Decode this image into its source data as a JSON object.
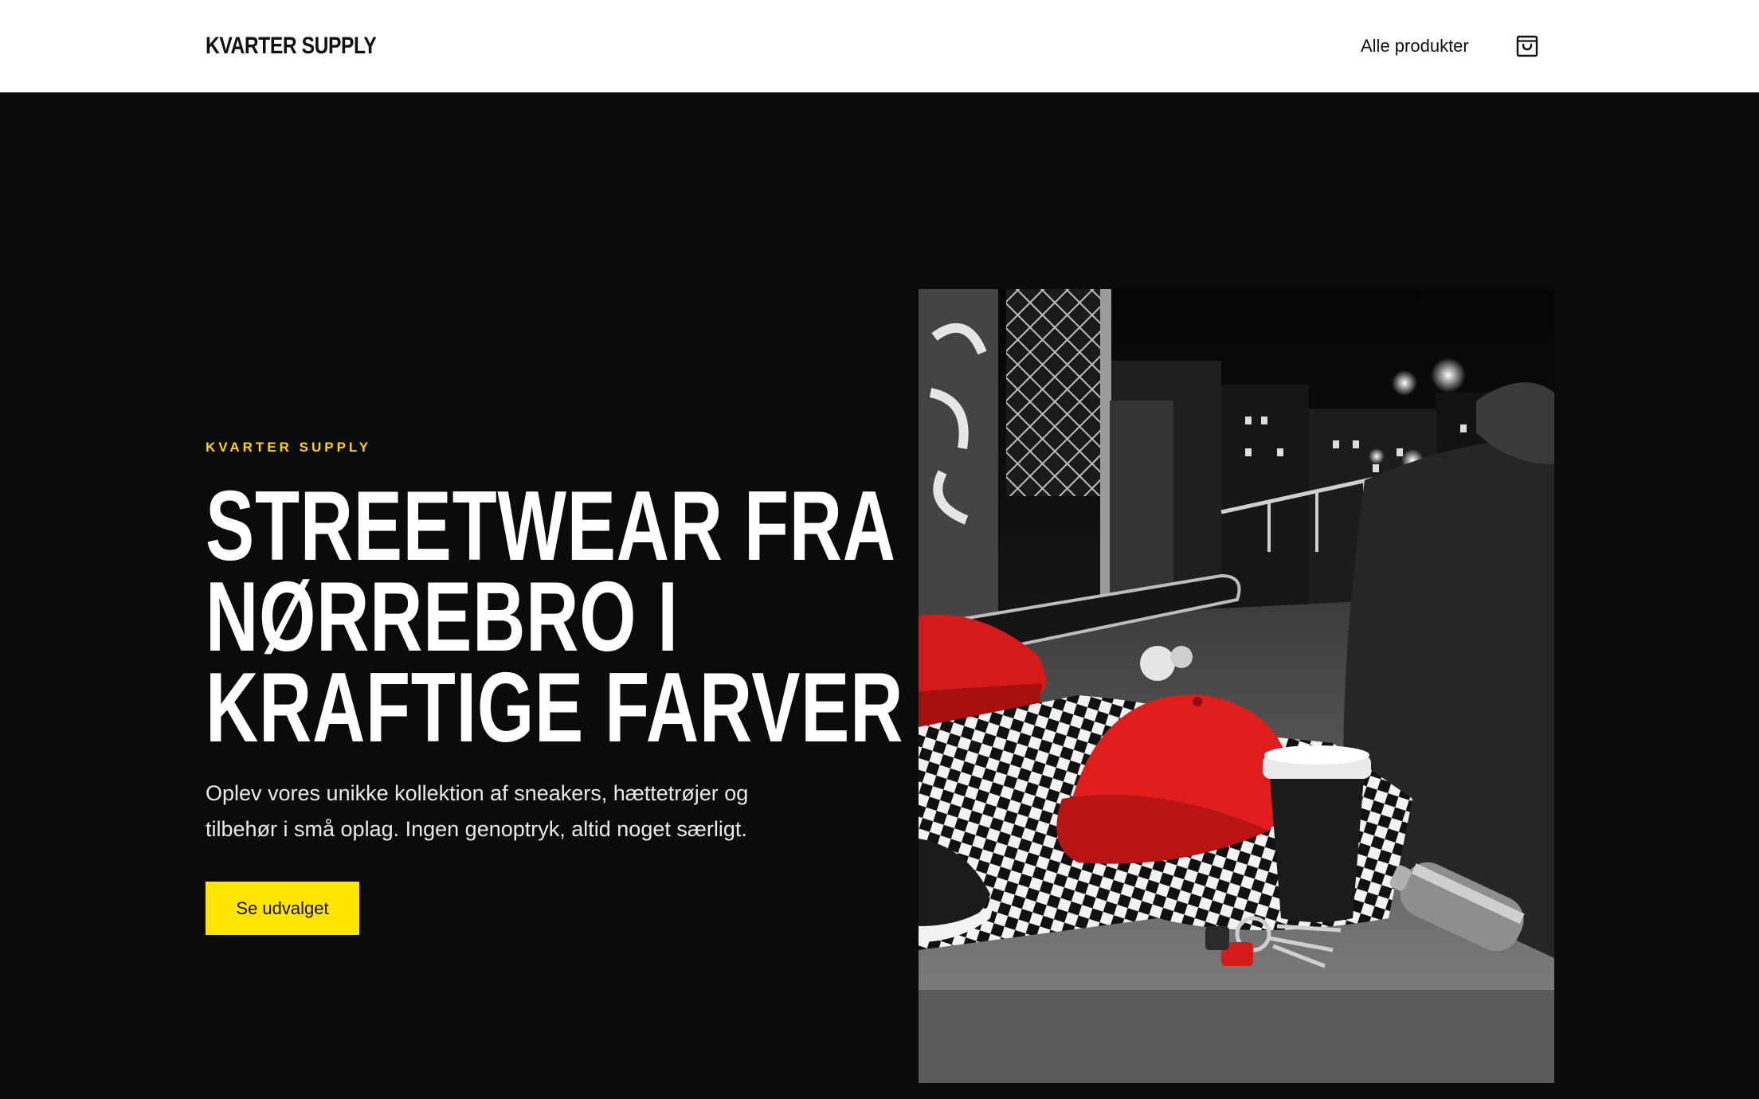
{
  "header": {
    "logo": "KVARTER SUPPLY",
    "nav_link": "Alle produkter",
    "cart_icon": "shopping-bag-icon"
  },
  "hero": {
    "eyebrow": "KVARTER SUPPLY",
    "headline_lines": [
      "STREETWEAR FRA",
      "NØRREBRO I",
      "KRAFTIGE FARVER"
    ],
    "lede": "Oplev vores unikke kollektion af sneakers, hættetrøjer og tilbehør i små oplag. Ingen genoptryk, altid noget særligt.",
    "cta_label": "Se udvalget",
    "image_icon": "street-photo-image"
  },
  "colors": {
    "accent": "#ffe500",
    "eyebrow": "#ffd400",
    "background": "#0b0b0b",
    "header_bg": "#ffffff",
    "photo_red": "#d41a1a"
  }
}
